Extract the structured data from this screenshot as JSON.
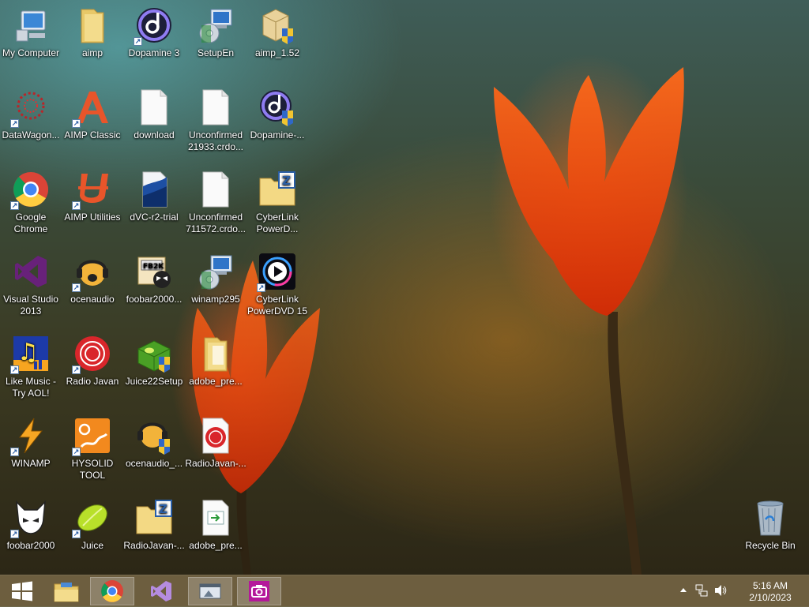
{
  "desktop": {
    "icons": [
      {
        "label": "My Computer",
        "icon": "computer-icon"
      },
      {
        "label": "aimp",
        "icon": "folder-icon"
      },
      {
        "label": "Dopamine 3",
        "icon": "dopamine-icon"
      },
      {
        "label": "SetupEn",
        "icon": "setup-icon"
      },
      {
        "label": "aimp_1.52",
        "icon": "installer-icon"
      },
      {
        "label": "DataWagon...",
        "icon": "datawagon-icon"
      },
      {
        "label": "AIMP Classic",
        "icon": "aimp-classic-icon"
      },
      {
        "label": "download",
        "icon": "file-icon"
      },
      {
        "label": "Unconfirmed 21933.crdo...",
        "icon": "file-icon"
      },
      {
        "label": "Dopamine-...",
        "icon": "dopamine-installer-icon"
      },
      {
        "label": "Google Chrome",
        "icon": "chrome-icon"
      },
      {
        "label": "AIMP Utilities",
        "icon": "aimp-utilities-icon"
      },
      {
        "label": "dVC-r2-trial",
        "icon": "dvc-icon"
      },
      {
        "label": "Unconfirmed 711572.crdo...",
        "icon": "file-icon"
      },
      {
        "label": "CyberLink PowerD...",
        "icon": "zip-folder-icon"
      },
      {
        "label": "Visual Studio 2013",
        "icon": "visual-studio-icon"
      },
      {
        "label": "ocenaudio",
        "icon": "ocenaudio-icon"
      },
      {
        "label": "foobar2000...",
        "icon": "foobar-installer-icon"
      },
      {
        "label": "winamp295",
        "icon": "setup-icon"
      },
      {
        "label": "CyberLink PowerDVD 15",
        "icon": "powerdvd-icon"
      },
      {
        "label": "Like Music - Try AOL!",
        "icon": "music-notes-icon"
      },
      {
        "label": "Radio Javan",
        "icon": "radio-javan-icon"
      },
      {
        "label": "Juice22Setup",
        "icon": "juice-setup-icon"
      },
      {
        "label": "adobe_pre...",
        "icon": "folder-icon"
      },
      {
        "label": "WINAMP",
        "icon": "winamp-icon"
      },
      {
        "label": "HYSOLID TOOL",
        "icon": "hysolid-icon"
      },
      {
        "label": "ocenaudio_...",
        "icon": "ocenaudio-installer-icon"
      },
      {
        "label": "RadioJavan-...",
        "icon": "radio-javan-file-icon"
      },
      {
        "label": "foobar2000",
        "icon": "foobar-icon"
      },
      {
        "label": "Juice",
        "icon": "juice-icon"
      },
      {
        "label": "RadioJavan-...",
        "icon": "zip-folder-icon"
      },
      {
        "label": "adobe_pre...",
        "icon": "exe-file-icon"
      },
      {
        "label": "Recycle Bin",
        "icon": "recycle-bin-icon"
      }
    ]
  },
  "taskbar": {
    "buttons": [
      {
        "name": "start-button",
        "icon": "windows-logo-icon"
      },
      {
        "name": "file-explorer-button",
        "icon": "file-explorer-icon"
      },
      {
        "name": "chrome-taskbar-button",
        "icon": "chrome-icon"
      },
      {
        "name": "visual-studio-taskbar-button",
        "icon": "visual-studio-icon"
      },
      {
        "name": "window-taskbar-button",
        "icon": "window-icon"
      },
      {
        "name": "camera-taskbar-button",
        "icon": "camera-icon"
      }
    ],
    "tray": {
      "time": "5:16 AM",
      "date": "2/10/2023",
      "icons": [
        "chevron-up-icon",
        "network-icon",
        "speaker-icon"
      ]
    }
  }
}
